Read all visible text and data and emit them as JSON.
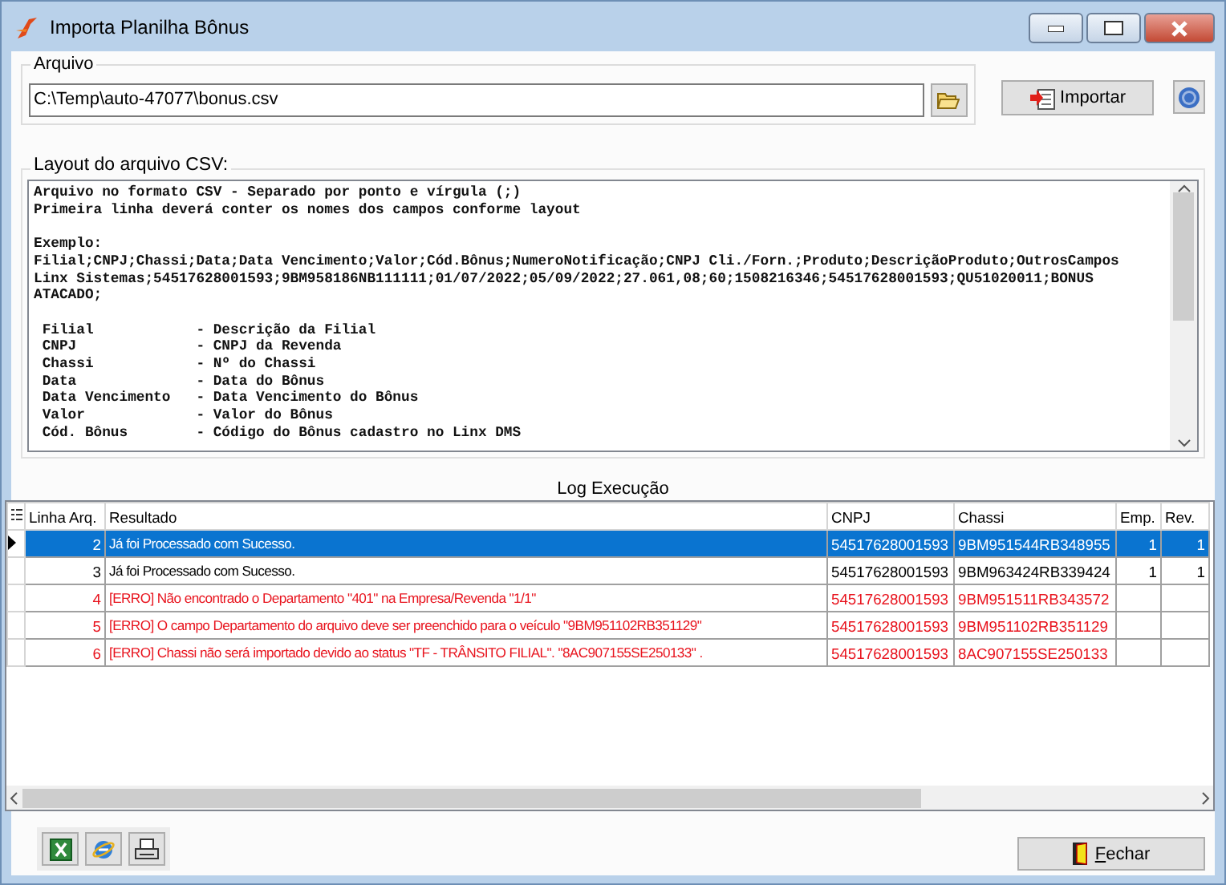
{
  "window": {
    "title": "Importa Planilha Bônus"
  },
  "file_group": {
    "label": "Arquivo",
    "path": "C:\\Temp\\auto-47077\\bonus.csv"
  },
  "import_button": {
    "label": "Importar"
  },
  "layout_group": {
    "label": "Layout do arquivo CSV:",
    "lines": [
      [
        "Arquivo no formato CSV - Separado por ponto e vírgula (;)",
        "Primeira linha deverá conter os nomes dos campos conforme layout"
      ],
      [
        "Exemplo:",
        "Filial;CNPJ;Chassi;Data;Data Vencimento;Valor;Cód.Bônus;NumeroNotificação;CNPJ Cli./Forn.;Produto;DescriçãoProduto;OutrosCampos",
        "Linx Sistemas;54517628001593;9BM958186NB111111;01/07/2022;05/09/2022;27.061,08;60;1508216346;54517628001593;QU51020011;BONUS",
        "ATACADO;"
      ],
      [
        " Filial            - Descrição da Filial",
        " CNPJ              - CNPJ da Revenda",
        " Chassi            - Nº do Chassi",
        " Data              - Data do Bônus",
        " Data Vencimento   - Data Vencimento do Bônus",
        " Valor             - Valor do Bônus",
        " Cód. Bônus        - Código do Bônus cadastro no Linx DMS"
      ]
    ]
  },
  "log": {
    "title": "Log Execução",
    "columns": [
      "Linha Arq.",
      "Resultado",
      "CNPJ",
      "Chassi",
      "Emp.",
      "Rev."
    ],
    "rows": [
      {
        "line": "2",
        "result": "Já foi Processado com Sucesso.",
        "cnpj": "54517628001593",
        "chassi": "9BM951544RB348955",
        "emp": "1",
        "rev": "1",
        "error": false,
        "selected": true
      },
      {
        "line": "3",
        "result": "Já foi Processado com Sucesso.",
        "cnpj": "54517628001593",
        "chassi": "9BM963424RB339424",
        "emp": "1",
        "rev": "1",
        "error": false,
        "selected": false
      },
      {
        "line": "4",
        "result": "[ERRO] Não encontrado o Departamento \"401\" na Empresa/Revenda \"1/1\"",
        "cnpj": "54517628001593",
        "chassi": "9BM951511RB343572",
        "error": true,
        "selected": false
      },
      {
        "line": "5",
        "result": "[ERRO] O campo Departamento do arquivo deve ser preenchido para o veículo \"9BM951102RB351129\"",
        "cnpj": "54517628001593",
        "chassi": "9BM951102RB351129",
        "error": true,
        "selected": false
      },
      {
        "line": "6",
        "result": "[ERRO] Chassi não será importado devido ao status \"TF - TRÂNSITO FILIAL\". \"8AC907155SE250133\" .",
        "cnpj": "54517628001593",
        "chassi": "8AC907155SE250133",
        "error": true,
        "selected": false
      }
    ]
  },
  "close_button": {
    "label": "Fechar"
  }
}
